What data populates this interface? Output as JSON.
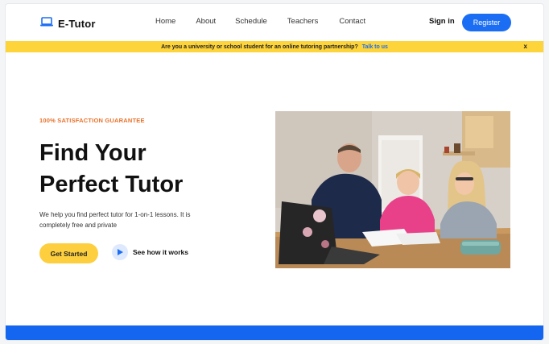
{
  "brand": {
    "name": "E-Tutor",
    "icon": "laptop-icon"
  },
  "nav": {
    "items": [
      "Home",
      "About",
      "Schedule",
      "Teachers",
      "Contact"
    ],
    "signin": "Sign in",
    "register": "Register"
  },
  "banner": {
    "text": "Are you a university or school student for an online tutoring partnership?",
    "link": "Talk to us",
    "close": "x"
  },
  "hero": {
    "eyebrow": "100% SATISFACTION GUARANTEE",
    "title_line1": "Find Your",
    "title_line2": "Perfect Tutor",
    "description": "We help you find perfect tutor for 1-on-1 lessons. It is completely free and private",
    "cta": "Get Started",
    "secondary": "See how it works"
  },
  "colors": {
    "accent_blue": "#1b6ef3",
    "banner_yellow": "#fed43b",
    "cta_yellow": "#fdcf3f",
    "eyebrow_orange": "#e8722b",
    "footer_blue": "#1466f0"
  }
}
